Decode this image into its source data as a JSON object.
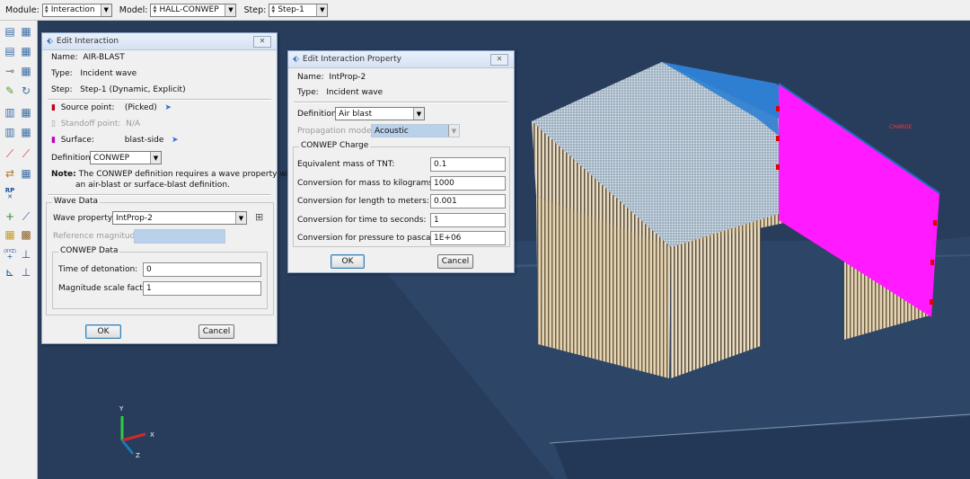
{
  "context_bar": {
    "module_label": "Module:",
    "module_value": "Interaction",
    "model_label": "Model:",
    "model_value": "HALL-CONWEP",
    "step_label": "Step:",
    "step_value": "Step-1"
  },
  "edit_interaction": {
    "title": "Edit Interaction",
    "name_label": "Name:",
    "name_value": "AIR-BLAST",
    "type_label": "Type:",
    "type_value": "Incident wave",
    "step_label": "Step:",
    "step_value": "Step-1 (Dynamic, Explicit)",
    "source_label": "Source point:",
    "source_value": "(Picked)",
    "standoff_label": "Standoff point:",
    "standoff_value": "N/A",
    "surface_label": "Surface:",
    "surface_value": "blast-side",
    "definition_label": "Definition:",
    "definition_value": "CONWEP",
    "note_label": "Note:",
    "note_line1": "The CONWEP definition requires a wave property with",
    "note_line2": "an air-blast or surface-blast definition.",
    "wave_data_title": "Wave Data",
    "wave_property_label": "Wave property:",
    "wave_property_value": "IntProp-2",
    "reference_magnitude_label": "Reference magnitude:",
    "conwep_data_title": "CONWEP Data",
    "time_detonation_label": "Time of detonation:",
    "time_detonation_value": "0",
    "magnitude_scale_label": "Magnitude scale factor:",
    "magnitude_scale_value": "1",
    "ok_label": "OK",
    "cancel_label": "Cancel"
  },
  "edit_interaction_property": {
    "title": "Edit Interaction Property",
    "name_label": "Name:",
    "name_value": "IntProp-2",
    "type_label": "Type:",
    "type_value": "Incident wave",
    "definition_label": "Definition:",
    "definition_value": "Air blast",
    "propagation_label": "Propagation model:",
    "propagation_value": "Acoustic",
    "conwep_charge_title": "CONWEP Charge",
    "tnt_label": "Equivalent mass of TNT:",
    "tnt_value": "0.1",
    "mass_conv_label": "Conversion for mass to kilograms:",
    "mass_conv_value": "1000",
    "length_conv_label": "Conversion for length to meters:",
    "length_conv_value": "0.001",
    "time_conv_label": "Conversion for time to seconds:",
    "time_conv_value": "1",
    "pressure_conv_label": "Conversion for pressure to pascals:",
    "pressure_conv_value": "1E+06",
    "ok_label": "OK",
    "cancel_label": "Cancel"
  },
  "viewport": {
    "charge_label": "CHARGE",
    "triad_y": "Y",
    "triad_x": "X",
    "triad_z": "Z"
  },
  "toolbox": {
    "rp_label": "RP",
    "xyz_label": "(XYZ)"
  },
  "colors": {
    "viewport_bg": "#283d5c",
    "surface_magenta": "#ff1aff",
    "roof_blue": "#2f7fd1"
  }
}
